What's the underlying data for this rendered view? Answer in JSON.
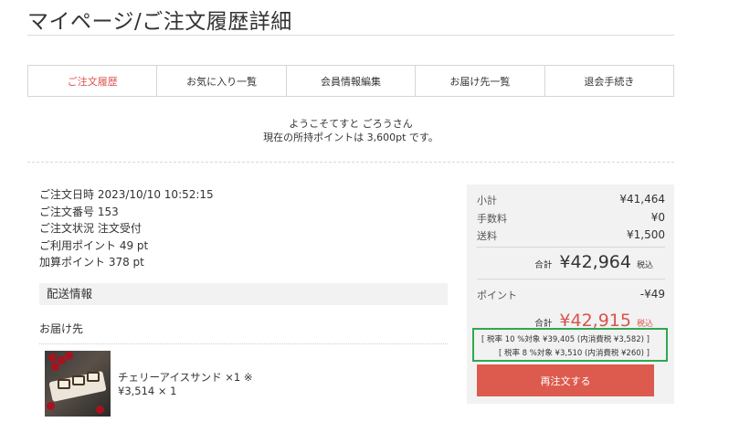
{
  "header": {
    "title": "マイページ/ご注文履歴詳細"
  },
  "tabs": [
    {
      "label": "ご注文履歴",
      "active": true
    },
    {
      "label": "お気に入り一覧",
      "active": false
    },
    {
      "label": "会員情報編集",
      "active": false
    },
    {
      "label": "お届け先一覧",
      "active": false
    },
    {
      "label": "退会手続き",
      "active": false
    }
  ],
  "welcome": {
    "line1": "ようこそてすと ごろうさん",
    "line2": "現在の所持ポイントは 3,600pt です。"
  },
  "order": {
    "date": "ご注文日時 2023/10/10 10:52:15",
    "number": "ご注文番号 153",
    "status": "ご注文状況 注文受付",
    "used_points": "ご利用ポイント 49 pt",
    "added_points": "加算ポイント 378 pt"
  },
  "shipping": {
    "heading": "配送情報",
    "recipient_label": "お届け先"
  },
  "product": {
    "name": "チェリーアイスサンド ×1 ※",
    "price": "¥3,514 × 1"
  },
  "summary": {
    "subtotal_label": "小計",
    "subtotal_value": "¥41,464",
    "fee_label": "手数料",
    "fee_value": "¥0",
    "shipping_label": "送料",
    "shipping_value": "¥1,500",
    "total_label": "合計",
    "total_value": "¥42,964",
    "total_tax": "税込",
    "points_label": "ポイント",
    "points_value": "-¥49",
    "grand_label": "合計",
    "grand_value": "¥42,915",
    "grand_tax": "税込",
    "tax10": "[ 税率 10 %対象 ¥39,405 (内消費税 ¥3,582) ]",
    "tax8": "[ 税率 8 %対象 ¥3,510 (内消費税 ¥260) ]",
    "reorder_label": "再注文する"
  },
  "colors": {
    "accent": "#d9534f",
    "button": "#dc5b4e",
    "highlight_box": "#2fa84f",
    "panel": "#f2f2f2"
  }
}
